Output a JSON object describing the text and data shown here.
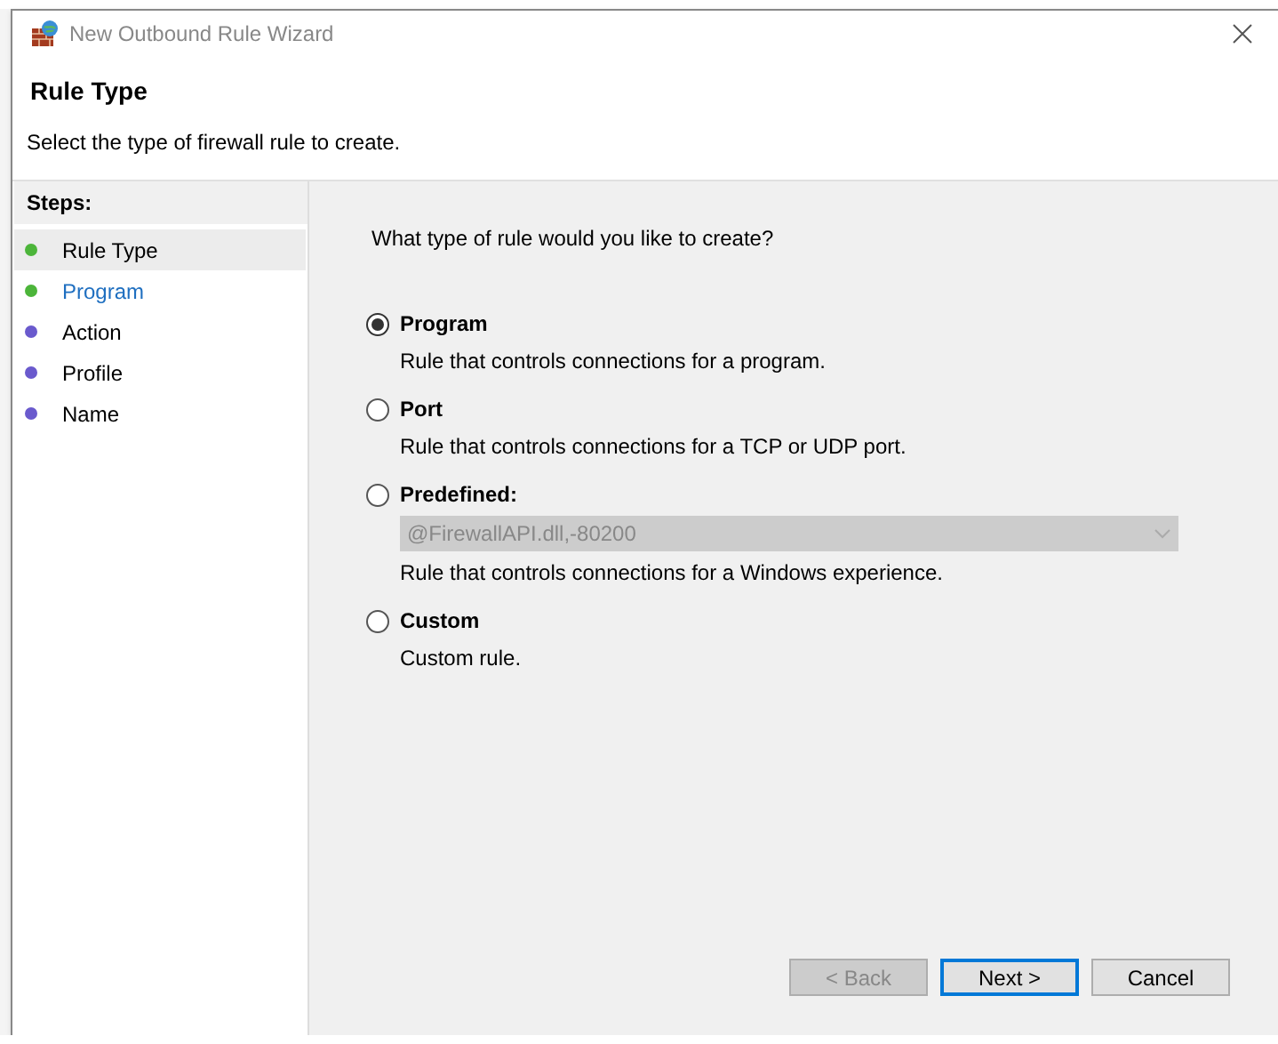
{
  "window": {
    "title": "New Outbound Rule Wizard"
  },
  "header": {
    "title": "Rule Type",
    "subtitle": "Select the type of firewall rule to create."
  },
  "steps": {
    "heading": "Steps:",
    "items": [
      {
        "label": "Rule Type",
        "selected": true,
        "completed": true,
        "link": false
      },
      {
        "label": "Program",
        "selected": false,
        "completed": true,
        "link": true
      },
      {
        "label": "Action",
        "selected": false,
        "completed": false,
        "link": false
      },
      {
        "label": "Profile",
        "selected": false,
        "completed": false,
        "link": false
      },
      {
        "label": "Name",
        "selected": false,
        "completed": false,
        "link": false
      }
    ]
  },
  "question": "What type of rule would you like to create?",
  "options": [
    {
      "label": "Program",
      "selected": true,
      "description": "Rule that controls connections for a program."
    },
    {
      "label": "Port",
      "selected": false,
      "description": "Rule that controls connections for a TCP or UDP port."
    },
    {
      "label": "Predefined:",
      "selected": false,
      "dropdown": {
        "value": "@FirewallAPI.dll,-80200",
        "disabled": true
      },
      "description": "Rule that controls connections for a Windows experience."
    },
    {
      "label": "Custom",
      "selected": false,
      "description": "Custom rule."
    }
  ],
  "buttons": [
    {
      "label": "< Back",
      "disabled": true,
      "focused": false
    },
    {
      "label": "Next >",
      "disabled": false,
      "focused": true
    },
    {
      "label": "Cancel",
      "disabled": false,
      "focused": false
    }
  ]
}
